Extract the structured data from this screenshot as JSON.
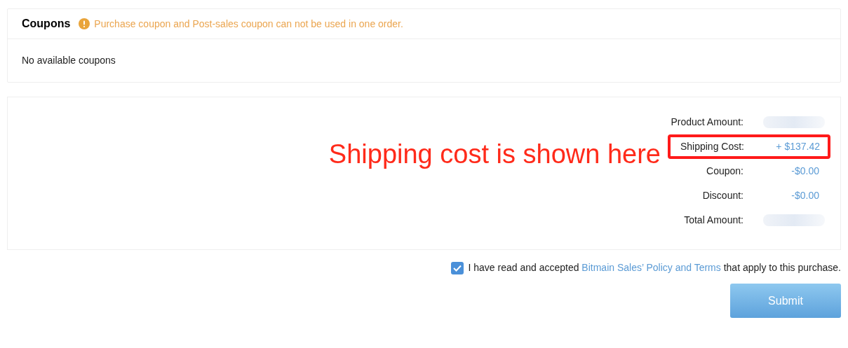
{
  "coupons": {
    "title": "Coupons",
    "warning": "Purchase coupon and Post-sales coupon can not be used in one order.",
    "empty_text": "No available coupons"
  },
  "annotation": {
    "text": "Shipping cost is shown here"
  },
  "summary": [
    {
      "label": "Product Amount:",
      "kind": "blurred",
      "highlighted": false
    },
    {
      "label": "Shipping Cost:",
      "kind": "value",
      "value": "+ $137.42",
      "highlighted": true
    },
    {
      "label": "Coupon:",
      "kind": "value",
      "value": "-$0.00",
      "highlighted": false
    },
    {
      "label": "Discount:",
      "kind": "value",
      "value": "-$0.00",
      "highlighted": false
    },
    {
      "label": "Total Amount:",
      "kind": "blurred",
      "highlighted": false
    }
  ],
  "agreement": {
    "checked": true,
    "text_before": "I have read and accepted",
    "link": "Bitmain Sales’ Policy and Terms",
    "text_after": "that apply to this purchase."
  },
  "submit": {
    "label": "Submit"
  }
}
